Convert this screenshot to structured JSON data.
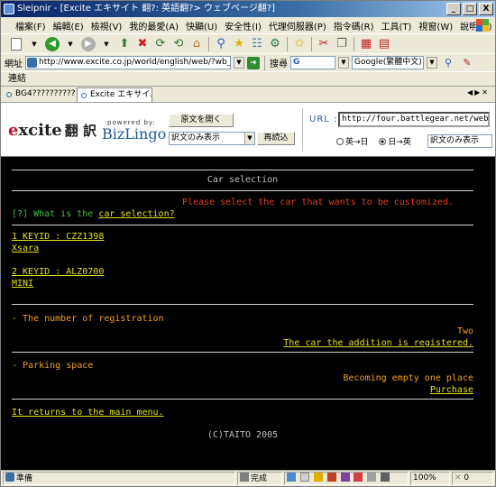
{
  "window": {
    "title": "Sleipnir - [Excite エキサイト 翻?: 英語翻?> ウェブページ翻?]",
    "buttons": [
      "_",
      "□",
      "X"
    ]
  },
  "menu": [
    "檔案(F)",
    "編輯(E)",
    "檢視(V)",
    "我的最愛(A)",
    "快顯(U)",
    "安全性(I)",
    "代理伺服器(P)",
    "指令碼(R)",
    "工具(T)",
    "視窗(W)",
    "說明(H)"
  ],
  "address": {
    "label": "網址",
    "url": "http://www.excite.co.jp/world/english/web/?wb_url=http://four.ba",
    "search_label": "搜尋",
    "search_value": "G",
    "engine": "Google(繁體中文)"
  },
  "links_label": "連結",
  "tabs": [
    {
      "label": "BG4??????????"
    },
    {
      "label": "Excite エキサイ..."
    }
  ],
  "excite": {
    "logo_e": "e",
    "logo_rest": "xcite",
    "logo_jp": "翻 訳",
    "powered_by": "powered by:",
    "bizlingo": "BizLingo",
    "original_button": "原文を開く",
    "view_select": "訳文のみ表示",
    "reload_button": "再読込",
    "url_label": "URL :",
    "url_value": "http://four.battlegear.net/web/",
    "radio_en_ja": "英→日",
    "radio_ja_en": "日→英",
    "view_select2": "訳文のみ表示"
  },
  "game": {
    "heading": "Car selection",
    "instruction": "Please select the car that wants to be customized.",
    "help_prefix": "[?] What is the ",
    "help_link": "car selection?",
    "cars": [
      {
        "keyid": "1 KEYID : CZZ1398",
        "name": "Xsara"
      },
      {
        "keyid": "2 KEYID : ALZ0700",
        "name": "MINI"
      }
    ],
    "registration_label": "- The number of registration",
    "registration_value": "Two",
    "registration_link": "The car the addition is registered.",
    "parking_label": "- Parking space",
    "parking_value": "Becoming empty one place",
    "parking_link": "Purchase",
    "return_link": "It returns to the main menu.",
    "copyright": "(C)TAITO 2005"
  },
  "status": {
    "left": "準備",
    "done": "完成",
    "zoom": "100%",
    "count": "0"
  }
}
